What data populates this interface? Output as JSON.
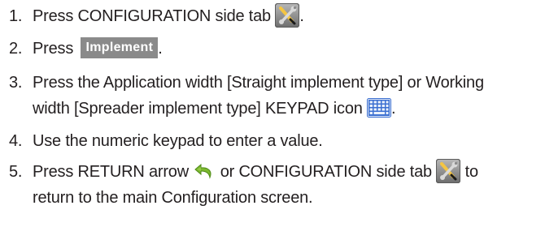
{
  "steps": [
    {
      "number": "1.",
      "parts": {
        "a": "Press CONFIGURATION side tab",
        "b": "."
      },
      "icons": [
        "configuration-tab-icon"
      ]
    },
    {
      "number": "2.",
      "parts": {
        "a": "Press",
        "button": "Implement",
        "b": "."
      }
    },
    {
      "number": "3.",
      "line1": "Press the Application width [Straight implement type] or Working",
      "line2": "width [Spreader implement type] KEYPAD icon",
      "line2_end": ".",
      "icons": [
        "keypad-icon"
      ]
    },
    {
      "number": "4.",
      "line1": "Use the numeric keypad to enter a value."
    },
    {
      "number": "5.",
      "line1_a": "Press RETURN arrow",
      "line1_b": "or CONFIGURATION side tab",
      "line1_c": "to",
      "line2": "return to the main Configuration screen.",
      "icons": [
        "return-arrow-icon",
        "configuration-tab-icon"
      ]
    }
  ],
  "colors": {
    "text": "#231f20",
    "button_bg": "#8a8a8a",
    "button_text": "#ffffff",
    "return_arrow": "#7cb82f",
    "keypad": "#3b6fd1"
  }
}
